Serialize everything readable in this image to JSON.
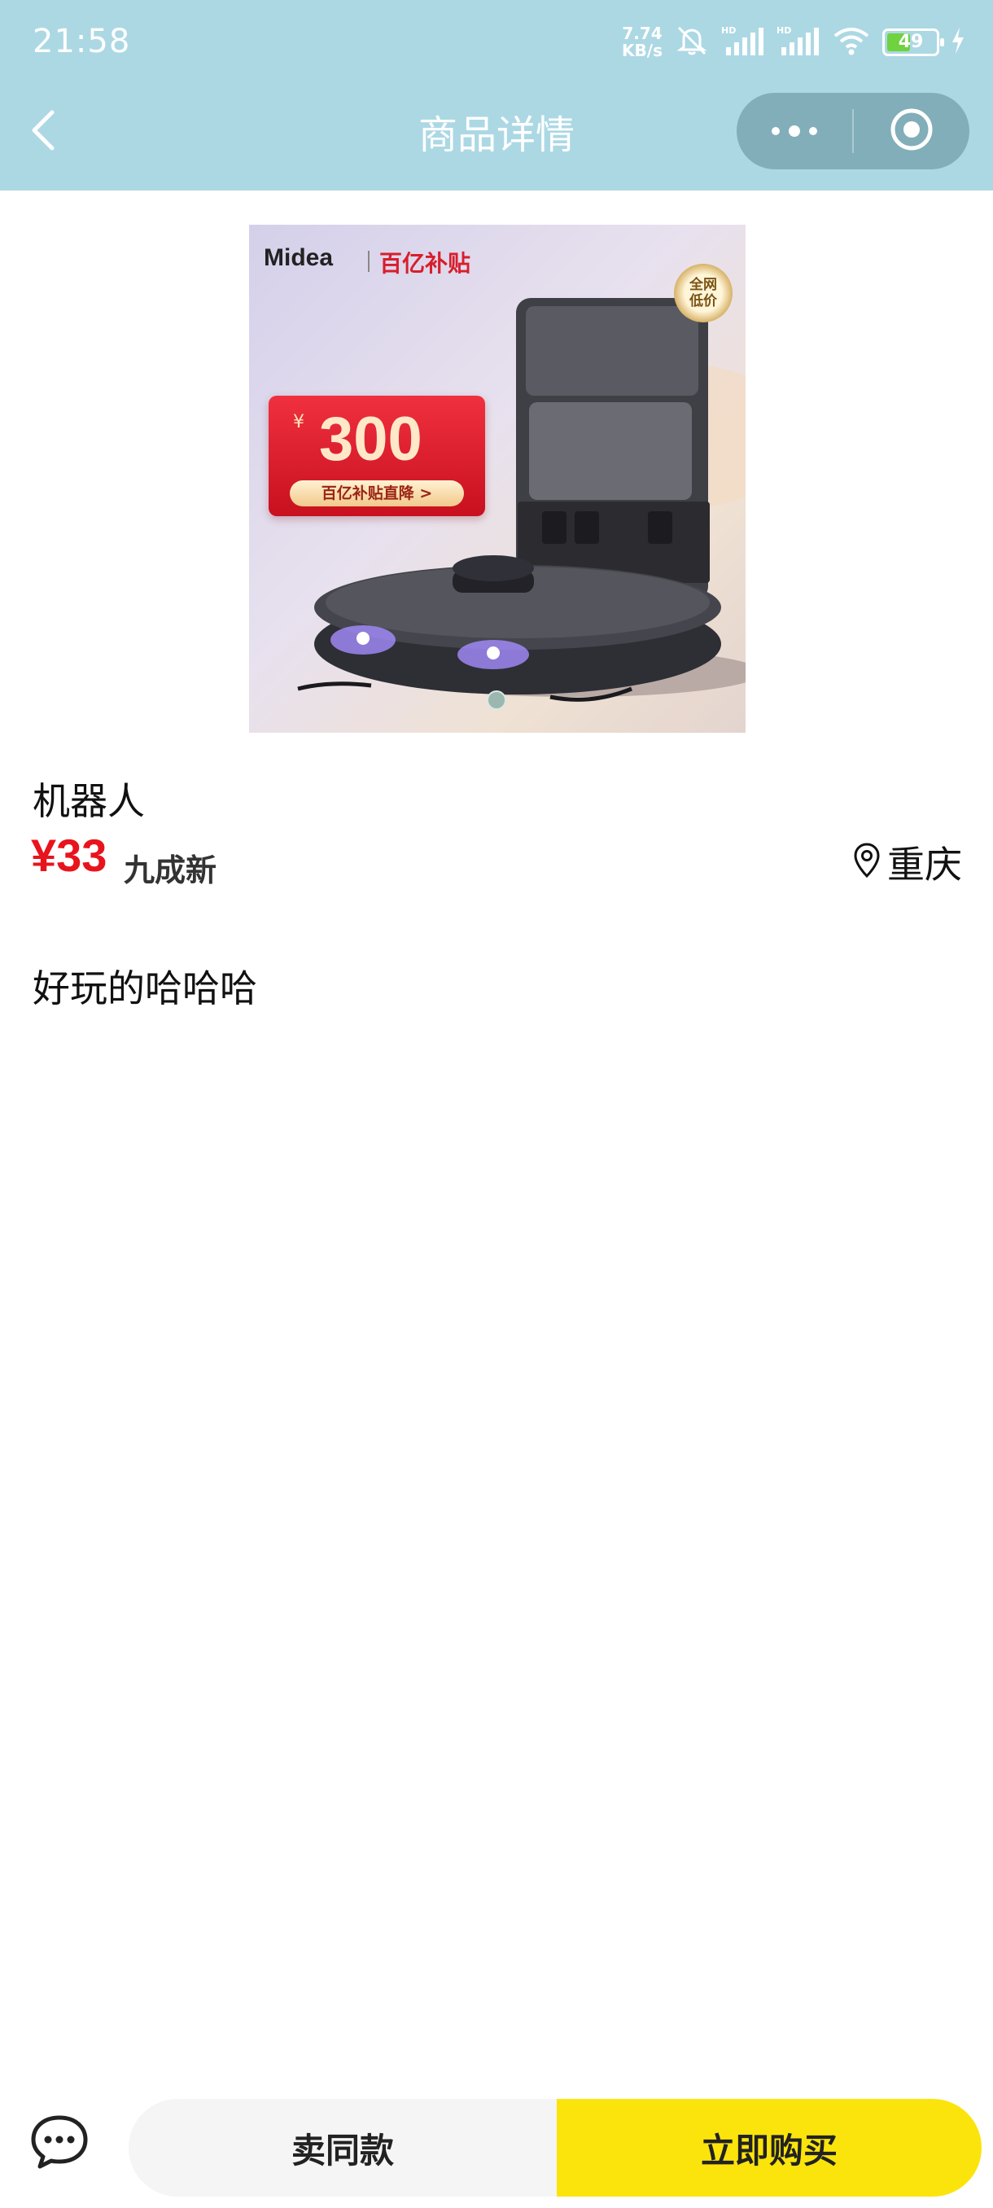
{
  "status_bar": {
    "time": "21:58",
    "net_speed_value": "7.74",
    "net_speed_unit": "KB/s",
    "battery_level": "49",
    "battery_fraction": 0.49,
    "icons": [
      "mute-icon",
      "signal-hd-icon",
      "signal-hd-icon",
      "wifi-icon",
      "battery-icon",
      "charging-icon"
    ]
  },
  "nav": {
    "title": "商品详情",
    "back_icon": "chevron-left-icon",
    "more_icon": "more-dots-icon",
    "close_icon": "target-circle-icon"
  },
  "product_image": {
    "brand": "Midea",
    "banner_tag": "百亿补贴",
    "corner_badge": "全网低价",
    "promo_currency": "¥",
    "promo_amount": "300",
    "promo_label": "百亿补贴直降 >"
  },
  "product": {
    "title": "机器人",
    "price": "¥33",
    "condition": "九成新",
    "location": "重庆",
    "description": "好玩的哈哈哈"
  },
  "bottom_bar": {
    "chat_icon": "chat-bubble-icon",
    "sell_same_label": "卖同款",
    "buy_now_label": "立即购买"
  },
  "colors": {
    "header_bg": "#acd8e4",
    "price_red": "#e8141d",
    "buy_button_yellow": "#fbe40c",
    "sell_button_gray": "#f5f5f5"
  }
}
